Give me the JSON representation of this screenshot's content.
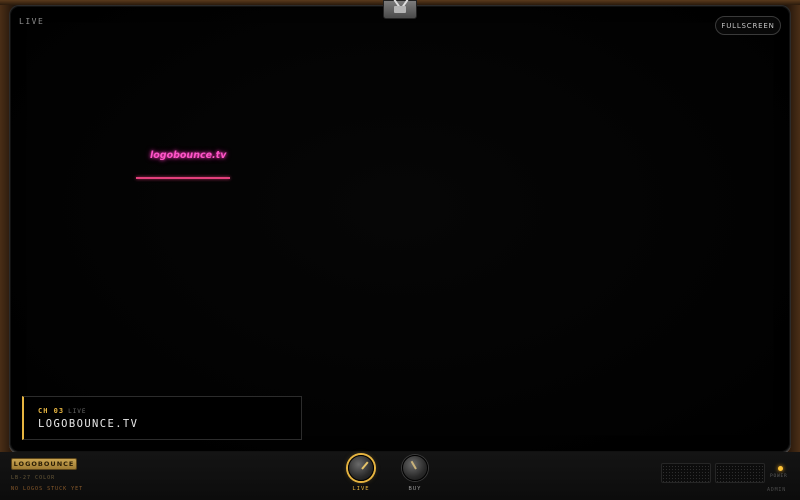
{
  "screen": {
    "live_tag": "LIVE",
    "fullscreen_label": "FULLSCREEN",
    "bouncing_logo": "logobounce.tv"
  },
  "channel": {
    "number": "CH 03",
    "status": "LIVE",
    "name": "LOGOBOUNCE.TV"
  },
  "panel": {
    "brand": "LOGOBOUNCE",
    "model": "LB-27 COLOR",
    "stuck_status": "NO LOGOS STUCK YET",
    "knobs": [
      {
        "label": "LIVE",
        "active": true
      },
      {
        "label": "BUY",
        "active": false
      }
    ],
    "power_label": "POWER",
    "admin_label": "ADMIN"
  },
  "colors": {
    "accent_gold": "#e6b440",
    "logo_pink": "#ff55c8",
    "floor_line": "#e2407c"
  },
  "icons": [
    "antenna-icon",
    "power-led-icon",
    "speaker-grille-icon"
  ]
}
